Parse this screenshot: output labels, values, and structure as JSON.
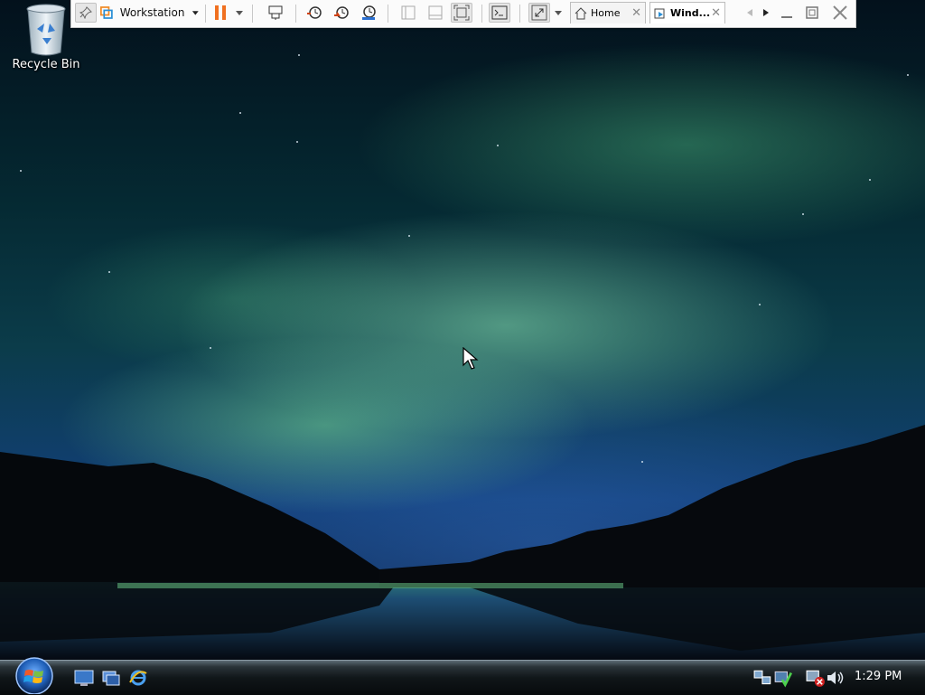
{
  "desktop": {
    "icons": [
      {
        "label": "Recycle Bin",
        "icon": "recycle-bin-icon"
      }
    ]
  },
  "vm_toolbar": {
    "vm_menu_label": "Workstation",
    "tabs": [
      {
        "label": "Home",
        "icon": "home-icon",
        "active": false
      },
      {
        "label": "Wind...",
        "icon": "vm-icon",
        "active": true
      }
    ],
    "close_glyph": "✕",
    "colors": {
      "pause_accent": "#f07020",
      "snapshot_accent": "#d04010"
    }
  },
  "taskbar": {
    "quick_launch": [
      "show-desktop-icon",
      "switch-windows-icon",
      "internet-explorer-icon"
    ],
    "tray_icons": [
      "network-icon",
      "vmware-tools-icon",
      "network-disconnected-icon",
      "speaker-icon"
    ],
    "clock": "1:29 PM"
  }
}
